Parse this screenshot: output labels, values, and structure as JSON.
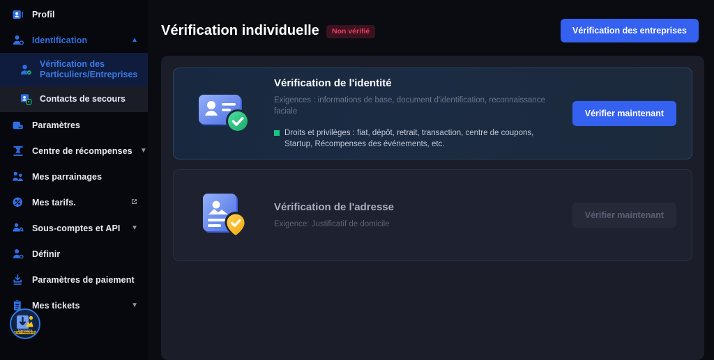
{
  "sidebar": {
    "items": [
      {
        "label": "Profil",
        "icon": "profile-card-icon",
        "chevron": null,
        "accent": false
      },
      {
        "label": "Identification",
        "icon": "user-check-icon",
        "chevron": "up",
        "accent": true
      }
    ],
    "sub_items": [
      {
        "label": "Vérification des Particuliers/Entreprises",
        "icon": "user-verified-icon",
        "state": "active"
      },
      {
        "label": "Contacts de secours",
        "icon": "contacts-icon",
        "state": "hover"
      }
    ],
    "items_after": [
      {
        "label": "Paramètres",
        "icon": "settings-icon",
        "chevron": null,
        "accent": false
      },
      {
        "label": "Centre de récompenses",
        "icon": "rewards-icon",
        "chevron": "down",
        "accent": false
      },
      {
        "label": "Mes parrainages",
        "icon": "referrals-icon",
        "chevron": null,
        "accent": false
      },
      {
        "label": "Mes tarifs.",
        "icon": "fees-icon",
        "chevron": "external",
        "accent": false
      },
      {
        "label": "Sous-comptes et API",
        "icon": "api-icon",
        "chevron": "down",
        "accent": false
      },
      {
        "label": "Définir",
        "icon": "define-icon",
        "chevron": null,
        "accent": false
      },
      {
        "label": "Paramètres de paiement",
        "icon": "payment-settings-icon",
        "chevron": null,
        "accent": false
      },
      {
        "label": "Mes tickets",
        "icon": "tickets-icon",
        "chevron": "down",
        "accent": false
      }
    ],
    "avatar": {
      "name": "avatar",
      "text_top": "Download &",
      "text_bottom": "Earn Rewards"
    }
  },
  "header": {
    "title": "Vérification individuelle",
    "badge": "Non vérifié",
    "business_button": "Vérification des entreprises"
  },
  "cards": [
    {
      "id": "identity",
      "title": "Vérification de l'identité",
      "requirements": "Exigences : informations de base, document d'identification, reconnaissance faciale",
      "perks": "Droits et privilèges : fiat, dépôt, retrait, transaction, centre de coupons, Startup, Récompenses des événements, etc.",
      "button": "Vérifier maintenant",
      "icon": "id-card-check-icon",
      "disabled": false
    },
    {
      "id": "address",
      "title": "Vérification de l'adresse",
      "requirements": "Exigence: Justificatif de domicile",
      "perks": "",
      "button": "Vérifier maintenant",
      "icon": "address-document-pin-icon",
      "disabled": true
    }
  ],
  "colors": {
    "accent_blue": "#3461f0",
    "link_blue": "#3b7ae8",
    "badge_red": "#ec3e5e",
    "badge_bg": "#3b1220",
    "perk_green": "#16c784",
    "pin_yellow": "#f5b318",
    "sidebar_bg": "#07080d",
    "panel_bg": "#1b1e29"
  }
}
